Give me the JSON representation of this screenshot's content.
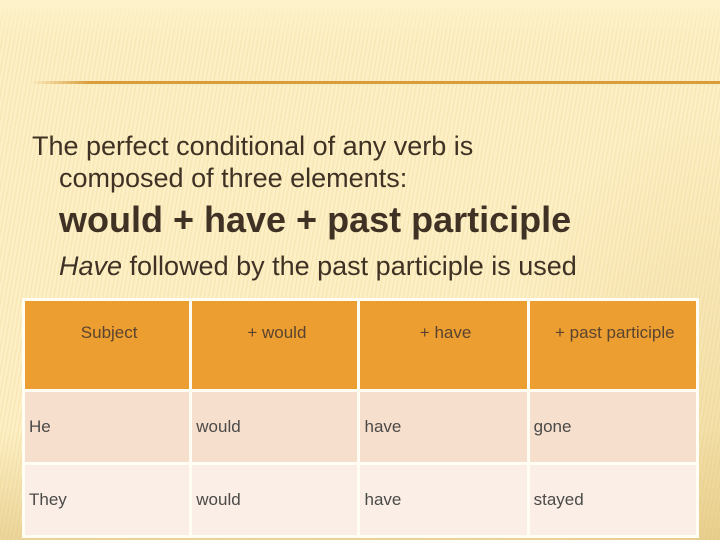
{
  "slide": {
    "paragraph": {
      "line1": "The perfect conditional of any verb is",
      "line2": "composed of three elements:",
      "formula": "would + have + past participle",
      "usage_em": "Have",
      "usage_rest": " followed by the past participle is used"
    },
    "table": {
      "headers": [
        "Subject",
        "+ would",
        "+ have",
        "+ past participle"
      ],
      "rows": [
        [
          "He",
          "would",
          "have",
          "gone"
        ],
        [
          "They",
          "would",
          "have",
          "stayed"
        ]
      ]
    },
    "colors": {
      "background": "#fdf0c6",
      "rule": "#d99d3c",
      "header_fill": "#ec9e30",
      "row_odd_fill": "#f6dfcd",
      "row_even_fill": "#faeee6",
      "text": "#3f3225"
    }
  }
}
